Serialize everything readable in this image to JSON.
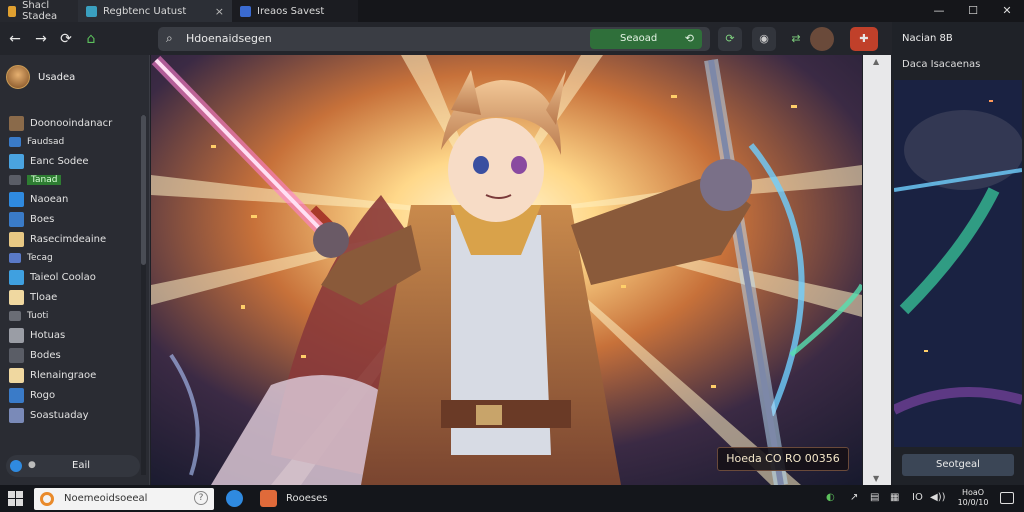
{
  "tabs": [
    {
      "title": "Shacl Stadea",
      "close": "×"
    },
    {
      "title": "Regbtenc Uatust",
      "close": "×"
    },
    {
      "title": "Ireaos Savest"
    }
  ],
  "window_controls": {
    "minimize": "—",
    "maximize": "☐",
    "close": "✕"
  },
  "toolbar": {
    "back": "←",
    "forward": "→",
    "reload": "⟳",
    "url": "Hdoenaidsegen",
    "go_label": "Seaoad"
  },
  "sidebar": {
    "profile_name": "Usadea",
    "items": [
      {
        "label": "Doonooindanacr",
        "color": "#8a6a4a",
        "size": "big"
      },
      {
        "label": "Faudsad",
        "color": "#3a7bc8",
        "size": "small"
      },
      {
        "label": "Eanc Sodee",
        "color": "#4aa3e0",
        "size": "big"
      },
      {
        "label": "Tanad",
        "color": "#5a5d66",
        "size": "small",
        "active": true
      },
      {
        "label": "Naoean",
        "color": "#2f8ae0",
        "size": "big"
      },
      {
        "label": "Boes",
        "color": "#3a7bc8",
        "size": "big"
      },
      {
        "label": "Rasecimdeaine",
        "color": "#e8c884",
        "size": "big"
      },
      {
        "label": "Tecag",
        "color": "#5a7ac8",
        "size": "small"
      },
      {
        "label": "Taieol Coolao",
        "color": "#3fa0e0",
        "size": "big"
      },
      {
        "label": "Tloae",
        "color": "#f0d8a0",
        "size": "big"
      },
      {
        "label": "Tuoti",
        "color": "#6a6d75",
        "size": "small"
      },
      {
        "label": "Hotuas",
        "color": "#9a9da5",
        "size": "big"
      },
      {
        "label": "Bodes",
        "color": "#5a5d66",
        "size": "big"
      },
      {
        "label": "Rlenaingraoe",
        "color": "#f0d8a0",
        "size": "big"
      },
      {
        "label": "Rogo",
        "color": "#3a7bc8",
        "size": "big"
      },
      {
        "label": "Soastuaday",
        "color": "#7a8ab8",
        "size": "big"
      }
    ],
    "footer_dot": "●",
    "footer_label": "Eail"
  },
  "main": {
    "badge": "Hoeda CO RO 00356"
  },
  "right_panel": {
    "title": "Nacian 8B",
    "subtitle": "Daca Isacaenas",
    "button": "Seotgeal"
  },
  "taskbar": {
    "search_text": "Noemeoidsoeeal",
    "help": "?",
    "app_label": "Rooeses",
    "tray": [
      "◐",
      "↗",
      "▤",
      "▦",
      "IO",
      "◀))"
    ],
    "clock_time": "HoaO",
    "clock_date": "10/0/10"
  },
  "colors": {
    "accent_green": "#2f6f3a",
    "taskbar": "#14161b",
    "sidebar": "#2a2c33"
  }
}
